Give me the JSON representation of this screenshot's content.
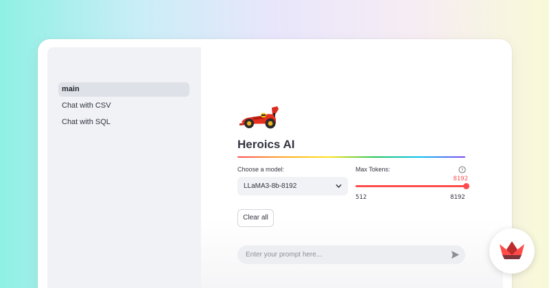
{
  "sidebar": {
    "items": [
      {
        "label": "main",
        "active": true
      },
      {
        "label": "Chat with CSV",
        "active": false
      },
      {
        "label": "Chat with SQL",
        "active": false
      }
    ]
  },
  "main": {
    "icon": "race-car-icon",
    "title": "Heroics AI",
    "model": {
      "label": "Choose a model:",
      "selected": "LLaMA3-8b-8192"
    },
    "tokens": {
      "label": "Max Tokens:",
      "value": "8192",
      "min": "512",
      "max": "8192",
      "fraction": 1.0
    },
    "clear_label": "Clear all",
    "prompt_placeholder": "Enter your prompt here...",
    "send_icon": "send-icon"
  },
  "colors": {
    "accent": "#ff4b4b",
    "sidebar_bg": "#f0f2f6",
    "text": "#31333f"
  },
  "logo": "streamlit-crown-logo"
}
